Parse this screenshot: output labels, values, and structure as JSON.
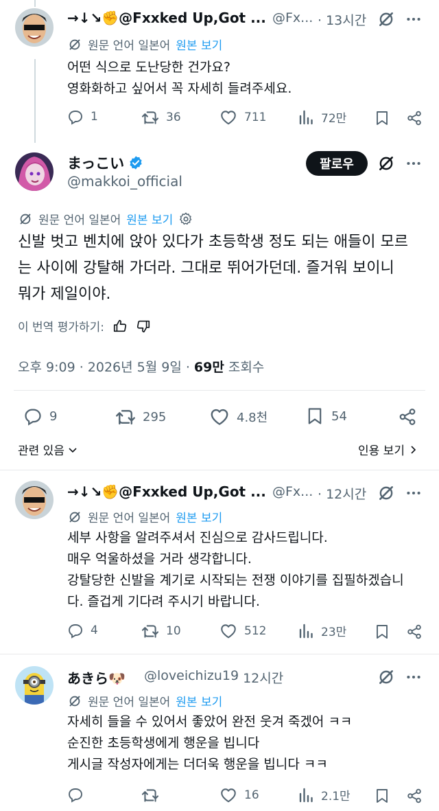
{
  "translate_label": "원문 언어 일본어",
  "show_original_label": "원본 보기",
  "reply1": {
    "name": "→↓↘✊@Fxxked Up,Got ...",
    "handle": "@Fx...",
    "time": "· 13시간",
    "lines": [
      "어떤 식으로 도난당한 건가요?",
      "영화화하고 싶어서 꼭 자세히 들려주세요."
    ],
    "stats": {
      "replies": "1",
      "reposts": "36",
      "likes": "711",
      "views": "72만"
    }
  },
  "main": {
    "name": "まっこい",
    "handle": "@makkoi_official",
    "follow_label": "팔로우",
    "lines": [
      "신발 벗고 벤치에 앉아 있다가 초등학생 정도 되는 애들이 모르",
      "는 사이에 강탈해 가더라. 그대로 뛰어가던데. 즐거워 보이니",
      "뭐가 제일이야."
    ],
    "rate_label": "이 번역 평가하기:",
    "timestamp": "오후 9:09 · 2026년 5월 9일 ·",
    "views_count": "69만",
    "views_label": "조회수",
    "stats": {
      "replies": "9",
      "reposts": "295",
      "likes": "4.8천",
      "bookmarks": "54"
    },
    "related_label": "관련 있음",
    "quotes_label": "인용 보기"
  },
  "reply2": {
    "name": "→↓↘✊@Fxxked Up,Got ...",
    "handle": "@Fx...",
    "time": "· 12시간",
    "lines": [
      "세부 사항을 알려주셔서 진심으로 감사드립니다.",
      "매우 억울하셨을 거라 생각합니다.",
      "강탈당한 신발을 계기로 시작되는 전쟁 이야기를 집필하겠습니",
      "다. 즐겁게 기다려 주시기 바랍니다."
    ],
    "stats": {
      "replies": "4",
      "reposts": "10",
      "likes": "512",
      "views": "23만"
    }
  },
  "reply3": {
    "name": "あきら🐶",
    "handle": "@loveichizu19",
    "time": "· 12시간",
    "lines": [
      "자세히 들을 수 있어서 좋았어 완전 웃겨 죽겠어 ㅋㅋ",
      "순진한 초등학생에게 행운을 빕니다",
      "게시글 작성자에게는 더더욱 행운을 빕니다 ㅋㅋ"
    ],
    "stats": {
      "replies": "",
      "reposts": "",
      "likes": "16",
      "views": "2.1만"
    }
  },
  "colors": {
    "accent": "#1d9bf0",
    "text": "#0f1419",
    "muted": "#536471",
    "verified": "#1d9bf0"
  },
  "icons": [
    "grok-icon",
    "more-icon",
    "reply-icon",
    "repost-icon",
    "like-icon",
    "views-icon",
    "bookmark-icon",
    "share-icon",
    "translate-icon",
    "settings-icon",
    "thumbs-up-icon",
    "thumbs-down-icon",
    "verified-icon",
    "chevron-down-icon",
    "chevron-right-icon"
  ]
}
